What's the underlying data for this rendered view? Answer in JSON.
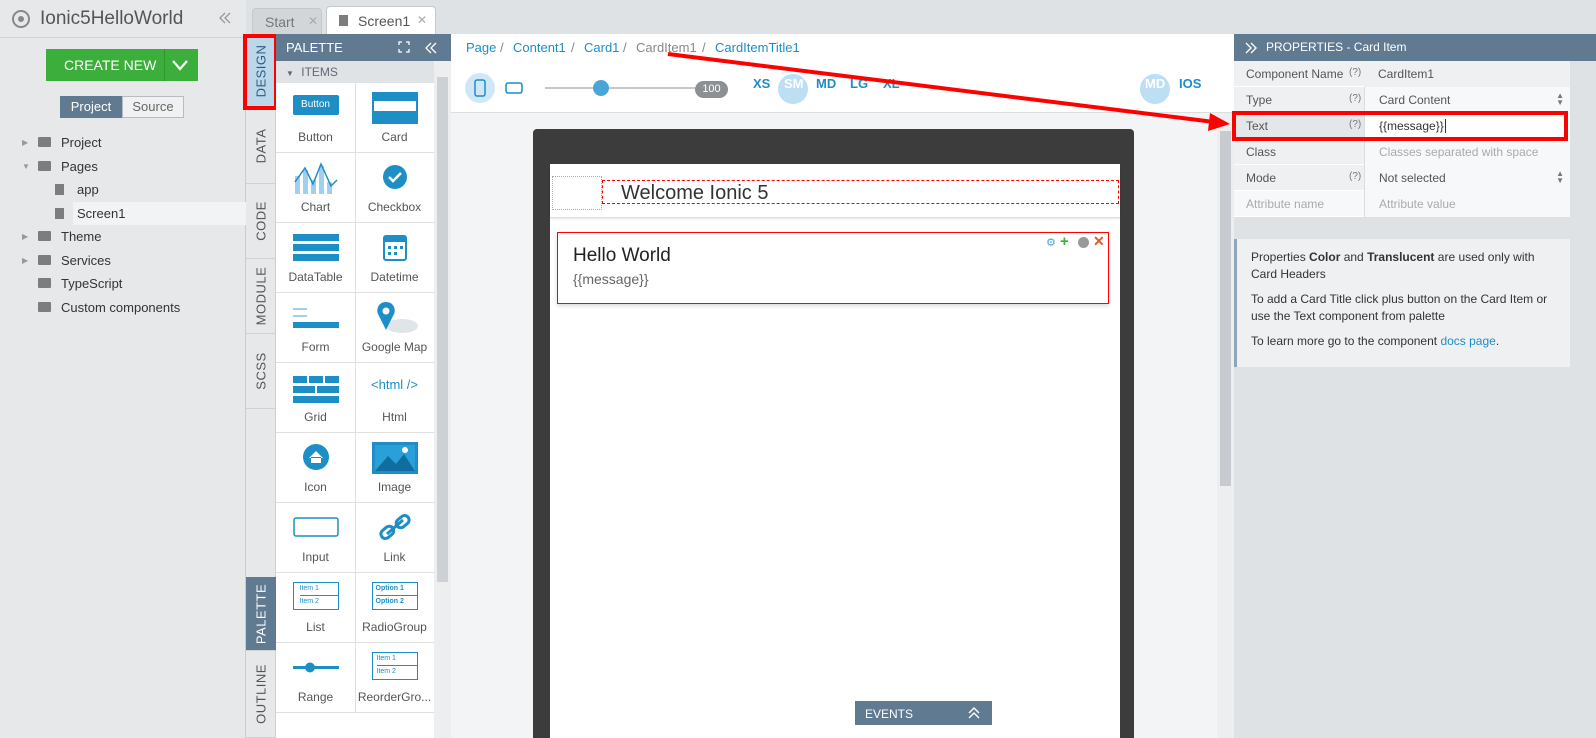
{
  "app": {
    "title": "Ionic5HelloWorld"
  },
  "tabs": [
    {
      "label": "Start"
    },
    {
      "label": "Screen1"
    }
  ],
  "create_new": {
    "label": "CREATE NEW"
  },
  "segment": {
    "project": "Project",
    "source": "Source"
  },
  "tree": [
    {
      "label": "Project"
    },
    {
      "label": "Pages"
    },
    {
      "label": "app"
    },
    {
      "label": "Screen1"
    },
    {
      "label": "Theme"
    },
    {
      "label": "Services"
    },
    {
      "label": "TypeScript"
    },
    {
      "label": "Custom components"
    }
  ],
  "vtabs": {
    "design": "DESIGN",
    "data": "DATA",
    "code": "CODE",
    "module": "MODULE",
    "scss": "SCSS",
    "palette": "PALETTE",
    "outline": "OUTLINE"
  },
  "palette": {
    "title": "PALETTE",
    "section": "ITEMS",
    "items": [
      {
        "label": "Button"
      },
      {
        "label": "Card"
      },
      {
        "label": "Chart"
      },
      {
        "label": "Checkbox"
      },
      {
        "label": "DataTable"
      },
      {
        "label": "Datetime"
      },
      {
        "label": "Form"
      },
      {
        "label": "Google Map"
      },
      {
        "label": "Grid"
      },
      {
        "label": "Html"
      },
      {
        "label": "Icon"
      },
      {
        "label": "Image"
      },
      {
        "label": "Input"
      },
      {
        "label": "Link"
      },
      {
        "label": "List"
      },
      {
        "label": "RadioGroup"
      },
      {
        "label": "Range"
      },
      {
        "label": "ReorderGro..."
      }
    ],
    "button_preview": "Button",
    "html_preview": "<html />",
    "list_preview": [
      "Item 1",
      "Item 2"
    ],
    "radio_preview": [
      "Option 1",
      "Option 2"
    ],
    "reorder_preview": [
      "Item 1",
      "Item 2"
    ]
  },
  "breadcrumb": [
    {
      "label": "Page"
    },
    {
      "label": "Content1"
    },
    {
      "label": "Card1"
    },
    {
      "label": "CardItem1"
    },
    {
      "label": "CardItemTitle1"
    }
  ],
  "breadcrumb_sep": "/",
  "toolbar": {
    "zoom": "100",
    "breakpoints": [
      "XS",
      "SM",
      "MD",
      "LG",
      "XL"
    ],
    "active_breakpoint": "SM",
    "mode_md": "MD",
    "mode_ios": "IOS"
  },
  "screen": {
    "header_title": "Welcome Ionic 5",
    "card_title": "Hello World",
    "card_text": "{{message}}"
  },
  "events": {
    "label": "EVENTS"
  },
  "properties": {
    "title": "PROPERTIES - Card Item",
    "help": "(?)",
    "rows": [
      {
        "key": "Component Name",
        "value": "CardItem1"
      },
      {
        "key": "Type",
        "value": "Card Content"
      },
      {
        "key": "Text",
        "value": "{{message}}"
      },
      {
        "key": "Class",
        "value": "Classes separated with space"
      },
      {
        "key": "Mode",
        "value": "Not selected"
      },
      {
        "key": "Attribute name",
        "value": "Attribute value"
      }
    ],
    "info": {
      "p1_a": "Properties ",
      "p1_b": "Color",
      "p1_c": " and ",
      "p1_d": "Translucent",
      "p1_e": " are used only with Card Headers",
      "p2": "To add a Card Title click plus button on the Card Item or use the Text component from palette",
      "p3_a": "To learn more go to the component ",
      "p3_link": "docs page",
      "p3_b": "."
    }
  },
  "colors": {
    "accent": "#1d8ec6",
    "header": "#5f7a91",
    "create": "#3cae3c",
    "highlight": "#ff0000"
  }
}
